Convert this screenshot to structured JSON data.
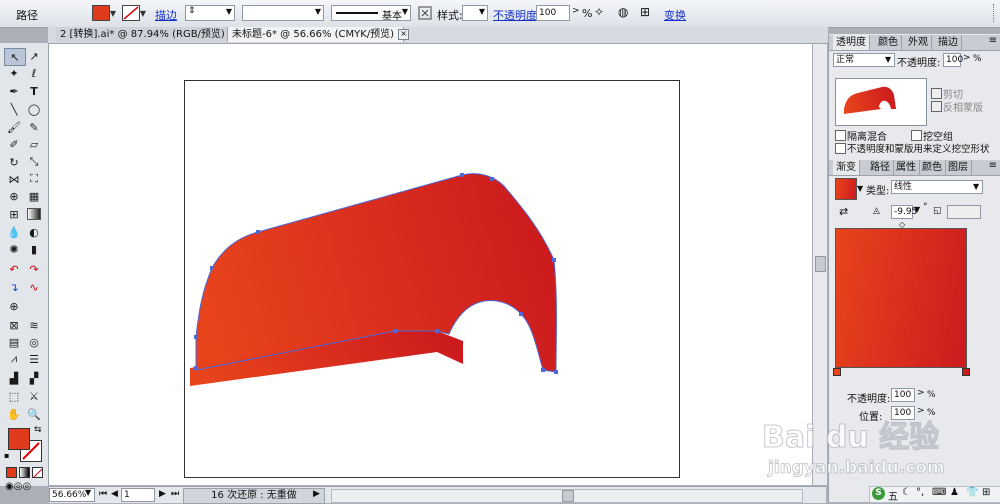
{
  "control_bar": {
    "object_type": "路径",
    "fill_color": "#e03a1c",
    "stroke_link": "描边",
    "stroke_style": "基本",
    "style_label": "样式:",
    "opacity_link": "不透明度",
    "opacity_value": "100",
    "opacity_unit": "%",
    "transform_link": "变换"
  },
  "document_tabs": [
    {
      "label": "2 [转换].ai* @ 87.94% (RGB/预览)"
    },
    {
      "label": "未标题-6* @ 56.66% (CMYK/预览)"
    }
  ],
  "status_bar": {
    "zoom": "56.66%",
    "page": "1",
    "status_text": "16 次还原 : 无重做"
  },
  "transparency_panel": {
    "tabs": [
      "透明度",
      "颜色",
      "外观",
      "描边"
    ],
    "blend_mode": "正常",
    "opacity_label": "不透明度:",
    "opacity_value": "100",
    "opacity_unit": "%",
    "clip_label": "剪切",
    "invert_mask_label": "反相蒙版",
    "isolate_blend_label": "隔离混合",
    "knockout_group_label": "挖空组",
    "opacity_mask_label": "不透明度和蒙版用来定义挖空形状"
  },
  "gradient_panel": {
    "tabs": [
      "渐变",
      "路径",
      "属性",
      "颜色",
      "图层"
    ],
    "type_label": "类型:",
    "type_value": "线性",
    "angle_value": "-9.95",
    "angle_unit": "°",
    "color_start": "#e8441c",
    "color_end": "#cc1a1e",
    "stop_opacity_label": "不透明度:",
    "stop_opacity_value": "100",
    "stop_opacity_unit": "%",
    "location_label": "位置:",
    "location_value": "100",
    "location_unit": "%"
  },
  "watermark": {
    "brand": "Bai du 经验",
    "url": "jingyan.baidu.com"
  },
  "tray": {
    "ime_label": "五"
  }
}
